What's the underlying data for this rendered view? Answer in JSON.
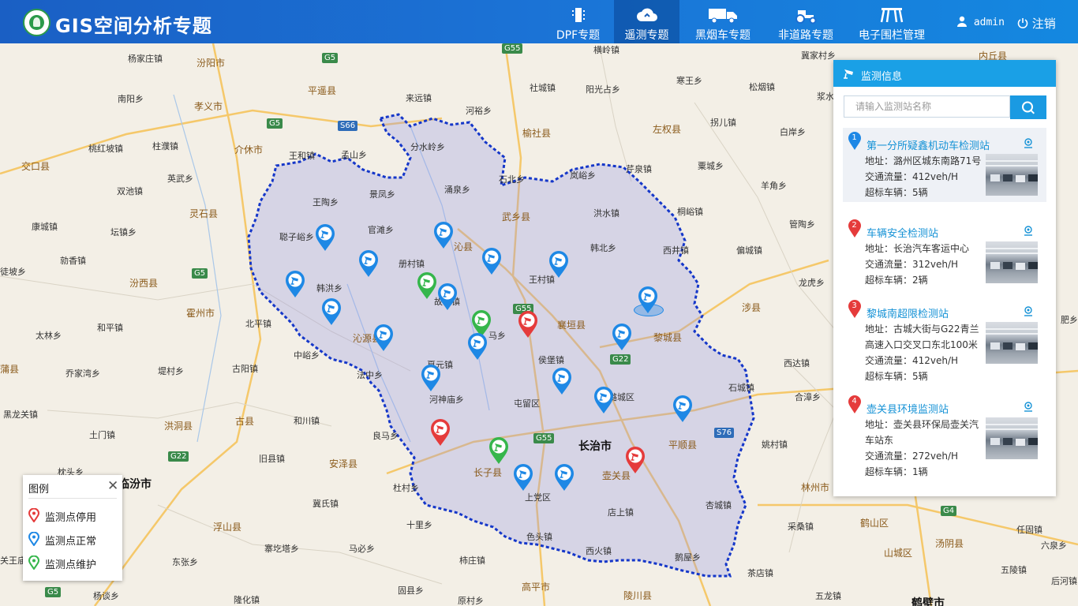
{
  "header": {
    "app_title": "GIS空间分析专题",
    "nav": [
      {
        "label": "DPF专题",
        "icon": "dpf-filter-icon"
      },
      {
        "label": "遥测专题",
        "icon": "cloud-icon",
        "active": true
      },
      {
        "label": "黑烟车专题",
        "icon": "truck-icon"
      },
      {
        "label": "非道路专题",
        "icon": "tractor-icon"
      },
      {
        "label": "电子围栏管理",
        "icon": "fence-icon"
      }
    ],
    "user": "admin",
    "logout": "注销"
  },
  "map": {
    "places": [
      {
        "name": "杨家庄镇"
      },
      {
        "name": "汾阳市",
        "type": "city"
      },
      {
        "name": "南阳乡"
      },
      {
        "name": "孝义市",
        "type": "city"
      },
      {
        "name": "平遥县",
        "type": "city"
      },
      {
        "name": "来远镇"
      },
      {
        "name": "河裕乡"
      },
      {
        "name": "社城镇"
      },
      {
        "name": "横岭镇"
      },
      {
        "name": "阳光占乡"
      },
      {
        "name": "寒王乡"
      },
      {
        "name": "松烟镇"
      },
      {
        "name": "冀家村乡"
      },
      {
        "name": "内丘县",
        "type": "city"
      },
      {
        "name": "桃红坡镇"
      },
      {
        "name": "柱濮镇"
      },
      {
        "name": "介休市",
        "type": "city"
      },
      {
        "name": "榆社县",
        "type": "city"
      },
      {
        "name": "左权县",
        "type": "city"
      },
      {
        "name": "拐儿镇"
      },
      {
        "name": "白岸乡"
      },
      {
        "name": "浆水"
      },
      {
        "name": "交口县",
        "type": "city"
      },
      {
        "name": "王和镇"
      },
      {
        "name": "孟山乡"
      },
      {
        "name": "分水岭乡"
      },
      {
        "name": "石北乡"
      },
      {
        "name": "岚峪乡"
      },
      {
        "name": "芹泉镇"
      },
      {
        "name": "粟城乡"
      },
      {
        "name": "英武乡"
      },
      {
        "name": "景凤乡"
      },
      {
        "name": "涌泉乡"
      },
      {
        "name": "羊角乡"
      },
      {
        "name": "双池镇"
      },
      {
        "name": "王陶乡"
      },
      {
        "name": "灵石县",
        "type": "city"
      },
      {
        "name": "武乡县",
        "type": "city"
      },
      {
        "name": "洪水镇"
      },
      {
        "name": "桐峪镇"
      },
      {
        "name": "康城镇"
      },
      {
        "name": "坛镇乡"
      },
      {
        "name": "聪子峪乡"
      },
      {
        "name": "官滩乡"
      },
      {
        "name": "沁县",
        "type": "city"
      },
      {
        "name": "管陶乡"
      },
      {
        "name": "勍香镇"
      },
      {
        "name": "册村镇"
      },
      {
        "name": "韩北乡"
      },
      {
        "name": "西井镇"
      },
      {
        "name": "偏城镇"
      },
      {
        "name": "徒坡乡"
      },
      {
        "name": "汾西县",
        "type": "city"
      },
      {
        "name": "韩洪乡"
      },
      {
        "name": "王村镇"
      },
      {
        "name": "龙虎乡"
      },
      {
        "name": "故县镇"
      },
      {
        "name": "涉县",
        "type": "city"
      },
      {
        "name": "霍州市",
        "type": "city"
      },
      {
        "name": "和平镇"
      },
      {
        "name": "北平镇"
      },
      {
        "name": "襄垣县",
        "type": "city"
      },
      {
        "name": "肥乡"
      },
      {
        "name": "太林乡"
      },
      {
        "name": "沁源县",
        "type": "city"
      },
      {
        "name": "马乡"
      },
      {
        "name": "黎城县",
        "type": "city"
      },
      {
        "name": "中峪乡"
      },
      {
        "name": "侯堡镇"
      },
      {
        "name": "西达镇"
      },
      {
        "name": "蒲县",
        "type": "city"
      },
      {
        "name": "乔家湾乡"
      },
      {
        "name": "堤村乡"
      },
      {
        "name": "古阳镇"
      },
      {
        "name": "法中乡"
      },
      {
        "name": "夏元镇"
      },
      {
        "name": "石城镇"
      },
      {
        "name": "合漳乡"
      },
      {
        "name": "河神庙乡"
      },
      {
        "name": "屯留区"
      },
      {
        "name": "潞城区"
      },
      {
        "name": "黑龙关镇"
      },
      {
        "name": "洪洞县",
        "type": "city"
      },
      {
        "name": "古县",
        "type": "city"
      },
      {
        "name": "和川镇"
      },
      {
        "name": "土门镇"
      },
      {
        "name": "良马乡"
      },
      {
        "name": "长治市",
        "type": "major"
      },
      {
        "name": "平顺县",
        "type": "city"
      },
      {
        "name": "姚村镇"
      },
      {
        "name": "旧县镇"
      },
      {
        "name": "安泽县",
        "type": "city"
      },
      {
        "name": "枕头乡"
      },
      {
        "name": "临汾市",
        "type": "major"
      },
      {
        "name": "长子县",
        "type": "city"
      },
      {
        "name": "壶关县",
        "type": "city"
      },
      {
        "name": "林州市",
        "type": "city"
      },
      {
        "name": "杜村乡"
      },
      {
        "name": "冀氏镇"
      },
      {
        "name": "上党区"
      },
      {
        "name": "杏城镇"
      },
      {
        "name": "店上镇"
      },
      {
        "name": "浮山县",
        "type": "city"
      },
      {
        "name": "十里乡"
      },
      {
        "name": "采桑镇"
      },
      {
        "name": "鹤山区",
        "type": "city"
      },
      {
        "name": "任固镇"
      },
      {
        "name": "色头镇"
      },
      {
        "name": "寨圪塔乡"
      },
      {
        "name": "马必乡"
      },
      {
        "name": "西火镇"
      },
      {
        "name": "汤阴县",
        "type": "city"
      },
      {
        "name": "山城区",
        "type": "city"
      },
      {
        "name": "关王庙"
      },
      {
        "name": "东张乡"
      },
      {
        "name": "柿庄镇"
      },
      {
        "name": "鹅屋乡"
      },
      {
        "name": "茶店镇"
      },
      {
        "name": "五陵镇"
      },
      {
        "name": "高平市",
        "type": "city"
      },
      {
        "name": "固县乡"
      },
      {
        "name": "杨谈乡"
      },
      {
        "name": "原村乡"
      },
      {
        "name": "陵川县",
        "type": "city"
      },
      {
        "name": "六泉乡"
      },
      {
        "name": "五龙镇"
      },
      {
        "name": "隆化镇"
      },
      {
        "name": "鹤壁市",
        "type": "major"
      },
      {
        "name": "后河镇"
      }
    ],
    "shields": [
      "G5",
      "G55",
      "G5",
      "S66",
      "G5",
      "G22",
      "S76",
      "G22",
      "G55",
      "G55",
      "G4",
      "G5"
    ]
  },
  "legend": {
    "title": "图例",
    "close": "✕",
    "items": [
      {
        "label": "监测点停用",
        "color": "#e53b3b"
      },
      {
        "label": "监测点正常",
        "color": "#1e88e5"
      },
      {
        "label": "监测点维护",
        "color": "#35b64b"
      }
    ]
  },
  "panel": {
    "title": "监测信息",
    "search_placeholder": "请输入监测站名称",
    "stations": [
      {
        "num": "1",
        "name": "第一分所疑鑫机动车检测站",
        "address": "地址：潞州区城东南路71号",
        "flow": "交通流量：412veh/H",
        "over": "超标车辆：5辆",
        "color": "#1e88e5"
      },
      {
        "num": "2",
        "name": "车辆安全检测站",
        "address": "地址：长治汽车客运中心",
        "flow": "交通流量：312veh/H",
        "over": "超标车辆：2辆",
        "color": "#e53b3b"
      },
      {
        "num": "3",
        "name": "黎城南超限检测站",
        "address": "地址：古城大街与G22青兰高速入口交叉口东北100米",
        "flow": "交通流量：412veh/H",
        "over": "超标车辆：5辆",
        "color": "#e53b3b"
      },
      {
        "num": "4",
        "name": "壶关县环境监测站",
        "address": "地址：壶关县环保局壶关汽车站东",
        "flow": "交通流量：272veh/H",
        "over": "超标车辆：1辆",
        "color": "#e53b3b"
      }
    ]
  },
  "colors": {
    "header": "#1b6fd2",
    "panel_head": "#1aa0e6",
    "stopped": "#e53b3b",
    "normal": "#1e88e5",
    "maintain": "#35b64b",
    "boundary": "#1537c9"
  }
}
